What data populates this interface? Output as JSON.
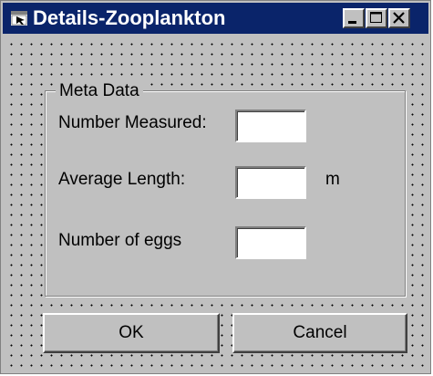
{
  "window": {
    "title": "Details-Zooplankton",
    "icon": "app-window-icon",
    "controls": {
      "minimize_icon": "minimize-icon",
      "maximize_icon": "maximize-icon",
      "close_icon": "close-icon"
    }
  },
  "group": {
    "legend": "Meta Data",
    "fields": [
      {
        "label": "Number Measured:",
        "value": "",
        "unit": ""
      },
      {
        "label": "Average Length:",
        "value": "",
        "unit": "m"
      },
      {
        "label": "Number of eggs",
        "value": "",
        "unit": ""
      }
    ]
  },
  "buttons": {
    "ok": "OK",
    "cancel": "Cancel"
  },
  "colors": {
    "titlebar": "#0a246a",
    "face": "#c0c0c0",
    "field": "#ffffff"
  }
}
